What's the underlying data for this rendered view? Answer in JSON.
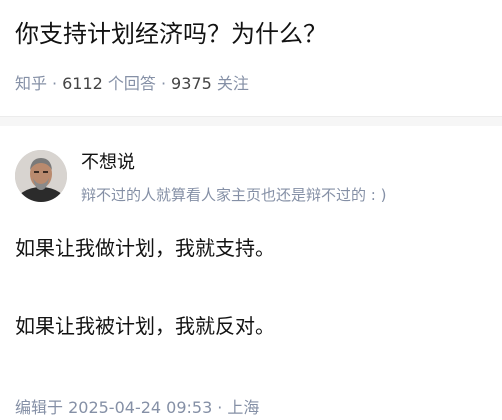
{
  "question": {
    "title": "你支持计划经济吗？为什么？"
  },
  "meta": {
    "site": "知乎",
    "answer_count": "6112",
    "answer_label": "个回答",
    "follow_count": "9375",
    "follow_label": "关注"
  },
  "author": {
    "name": "不想说",
    "bio": "辩不过的人就算看人家主页也还是辩不过的 : )"
  },
  "answer": {
    "paragraphs": [
      "如果让我做计划，我就支持。",
      "如果让我被计划，我就反对。"
    ]
  },
  "footer": {
    "edited_text": "编辑于 2025-04-24 09:53",
    "location": "上海"
  }
}
